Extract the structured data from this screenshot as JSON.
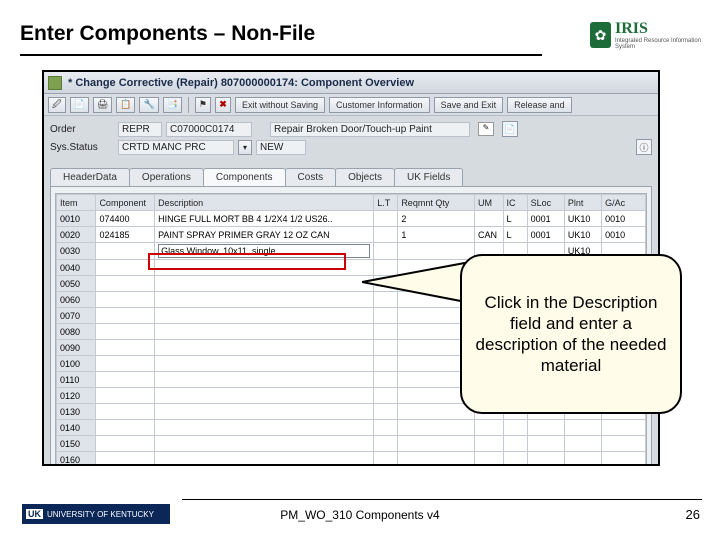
{
  "slide": {
    "title": "Enter Components – Non-File",
    "footer_text": "PM_WO_310 Components v4",
    "page_number": "26",
    "uk_logo_text": "UNIVERSITY OF KENTUCKY",
    "uk_badge": "UK",
    "iris_logo": "IRIS",
    "iris_sub": "Integrated Resource Information System"
  },
  "sap": {
    "window_title": "* Change Corrective  (Repair) 807000000174: Component Overview",
    "toolbar": {
      "exit_label": "Exit without Saving",
      "cust_info": "Customer Information",
      "save_exit": "Save and Exit",
      "release": "Release and"
    },
    "form": {
      "order_label": "Order",
      "order_type": "REPR",
      "order_no": "C07000C0174",
      "order_desc": "Repair Broken Door/Touch-up Paint",
      "status_label": "Sys.Status",
      "status_value": "CRTD  MANC  PRC",
      "status_pill": "NEW"
    },
    "tabs": [
      "HeaderData",
      "Operations",
      "Components",
      "Costs",
      "Objects",
      "UK Fields"
    ],
    "active_tab": "Components",
    "grid": {
      "columns": [
        "Item",
        "Component",
        "Description",
        "L.T",
        "Reqmnt Qty",
        "UM",
        "IC",
        "SLoc",
        "Plnt",
        "G/Ac"
      ],
      "rows": [
        {
          "item": "0010",
          "component": "074400",
          "description": "HINGE FULL MORT BB 4 1/2X4 1/2 US26..",
          "lt": "",
          "qty": "2",
          "um": "",
          "ic": "L",
          "sloc": "0001",
          "plnt": "UK10",
          "gsac": "0010"
        },
        {
          "item": "0020",
          "component": "024185",
          "description": "PAINT SPRAY PRIMER GRAY 12 OZ CAN",
          "lt": "",
          "qty": "1",
          "um": "CAN",
          "ic": "L",
          "sloc": "0001",
          "plnt": "UK10",
          "gsac": "0010"
        },
        {
          "item": "0030",
          "component": "",
          "description": "Glass Window, 10x11, single",
          "lt": "",
          "qty": "",
          "um": "",
          "ic": "",
          "sloc": "",
          "plnt": "UK10",
          "gsac": ""
        },
        {
          "item": "0040"
        },
        {
          "item": "0050"
        },
        {
          "item": "0060"
        },
        {
          "item": "0070"
        },
        {
          "item": "0080"
        },
        {
          "item": "0090"
        },
        {
          "item": "0100"
        },
        {
          "item": "0110"
        },
        {
          "item": "0120"
        },
        {
          "item": "0130"
        },
        {
          "item": "0140"
        },
        {
          "item": "0150"
        },
        {
          "item": "0160"
        }
      ]
    }
  },
  "callout": {
    "text": "Click in the Description field and enter a description of the needed material"
  }
}
